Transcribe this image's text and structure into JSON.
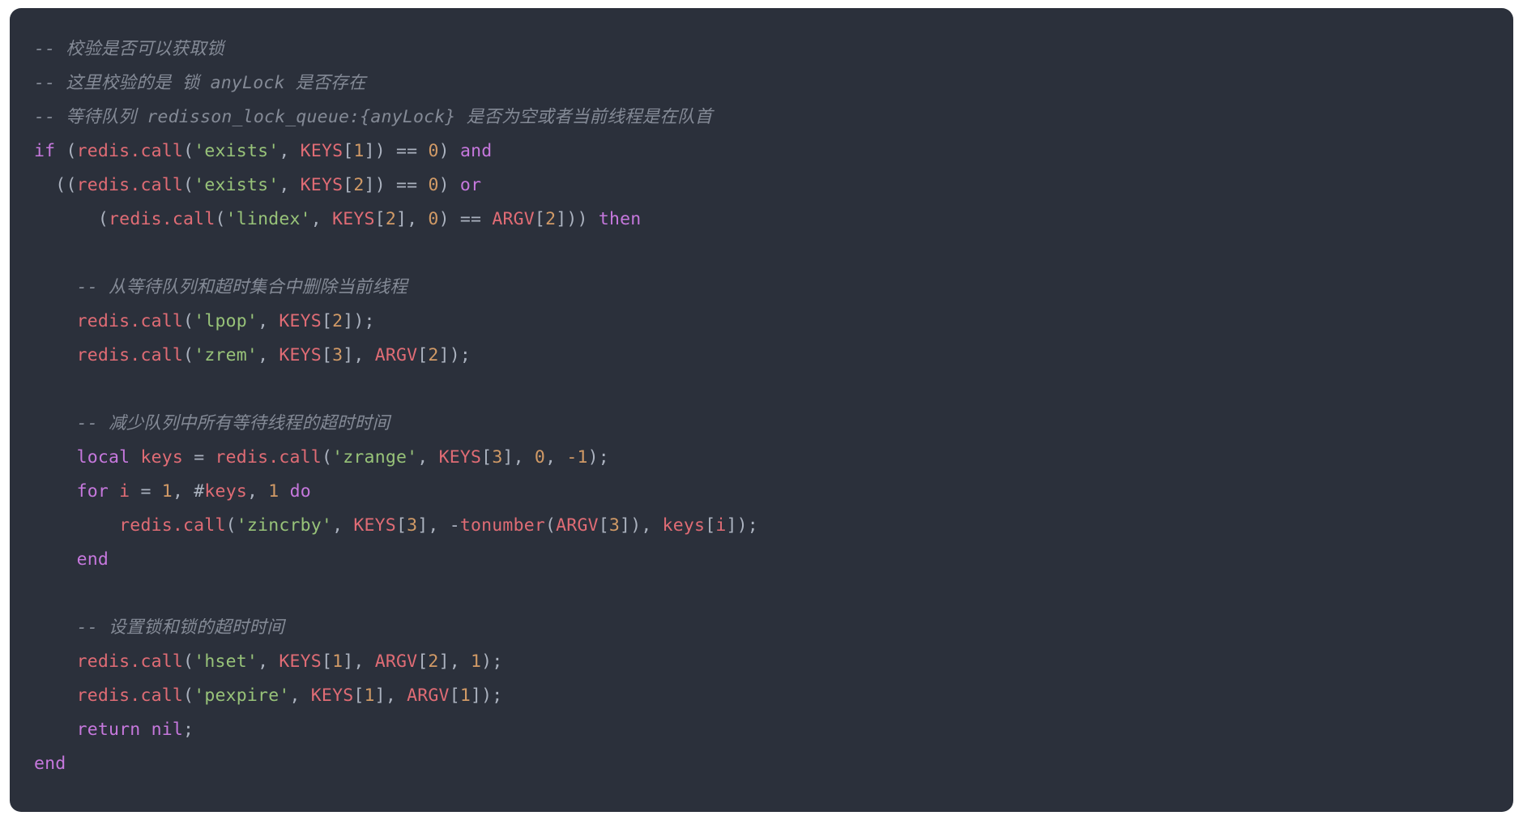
{
  "editor": {
    "language": "lua",
    "background_color": "#2b303b",
    "page_background_color": "#ffffff",
    "theme_colors": {
      "comment": "#848a96",
      "keyword": "#c678dd",
      "function": "#e06c75",
      "string": "#98c379",
      "number": "#d19a66",
      "punctuation": "#abb2bf"
    }
  },
  "code_lines": [
    {
      "id": "l01",
      "indent": 0,
      "tokens": [
        {
          "t": "comment",
          "v": "-- 校验是否可以获取锁"
        }
      ]
    },
    {
      "id": "l02",
      "indent": 0,
      "tokens": [
        {
          "t": "comment",
          "v": "-- 这里校验的是 锁 anyLock 是否存在"
        }
      ]
    },
    {
      "id": "l03",
      "indent": 0,
      "tokens": [
        {
          "t": "comment",
          "v": "-- 等待队列 redisson_lock_queue:{anyLock} 是否为空或者当前线程是在队首"
        }
      ]
    },
    {
      "id": "l04",
      "indent": 0,
      "tokens": [
        {
          "t": "keyword",
          "v": "if"
        },
        {
          "t": "plain",
          "v": " "
        },
        {
          "t": "punctuation",
          "v": "("
        },
        {
          "t": "function",
          "v": "redis.call"
        },
        {
          "t": "punctuation",
          "v": "("
        },
        {
          "t": "string",
          "v": "'exists'"
        },
        {
          "t": "punctuation",
          "v": ", "
        },
        {
          "t": "function",
          "v": "KEYS"
        },
        {
          "t": "punctuation",
          "v": "["
        },
        {
          "t": "number",
          "v": "1"
        },
        {
          "t": "punctuation",
          "v": "])"
        },
        {
          "t": "plain",
          "v": " "
        },
        {
          "t": "punctuation",
          "v": "=="
        },
        {
          "t": "plain",
          "v": " "
        },
        {
          "t": "number",
          "v": "0"
        },
        {
          "t": "punctuation",
          "v": ")"
        },
        {
          "t": "plain",
          "v": " "
        },
        {
          "t": "keyword",
          "v": "and"
        }
      ]
    },
    {
      "id": "l05",
      "indent": 0,
      "tokens": [
        {
          "t": "plain",
          "v": "  "
        },
        {
          "t": "punctuation",
          "v": "(("
        },
        {
          "t": "function",
          "v": "redis.call"
        },
        {
          "t": "punctuation",
          "v": "("
        },
        {
          "t": "string",
          "v": "'exists'"
        },
        {
          "t": "punctuation",
          "v": ", "
        },
        {
          "t": "function",
          "v": "KEYS"
        },
        {
          "t": "punctuation",
          "v": "["
        },
        {
          "t": "number",
          "v": "2"
        },
        {
          "t": "punctuation",
          "v": "])"
        },
        {
          "t": "plain",
          "v": " "
        },
        {
          "t": "punctuation",
          "v": "=="
        },
        {
          "t": "plain",
          "v": " "
        },
        {
          "t": "number",
          "v": "0"
        },
        {
          "t": "punctuation",
          "v": ")"
        },
        {
          "t": "plain",
          "v": " "
        },
        {
          "t": "keyword",
          "v": "or"
        }
      ]
    },
    {
      "id": "l06",
      "indent": 0,
      "tokens": [
        {
          "t": "plain",
          "v": "      "
        },
        {
          "t": "punctuation",
          "v": "("
        },
        {
          "t": "function",
          "v": "redis.call"
        },
        {
          "t": "punctuation",
          "v": "("
        },
        {
          "t": "string",
          "v": "'lindex'"
        },
        {
          "t": "punctuation",
          "v": ", "
        },
        {
          "t": "function",
          "v": "KEYS"
        },
        {
          "t": "punctuation",
          "v": "["
        },
        {
          "t": "number",
          "v": "2"
        },
        {
          "t": "punctuation",
          "v": "], "
        },
        {
          "t": "number",
          "v": "0"
        },
        {
          "t": "punctuation",
          "v": ")"
        },
        {
          "t": "plain",
          "v": " "
        },
        {
          "t": "punctuation",
          "v": "=="
        },
        {
          "t": "plain",
          "v": " "
        },
        {
          "t": "function",
          "v": "ARGV"
        },
        {
          "t": "punctuation",
          "v": "["
        },
        {
          "t": "number",
          "v": "2"
        },
        {
          "t": "punctuation",
          "v": "]))"
        },
        {
          "t": "plain",
          "v": " "
        },
        {
          "t": "keyword",
          "v": "then"
        }
      ]
    },
    {
      "id": "l07",
      "indent": 0,
      "tokens": []
    },
    {
      "id": "l08",
      "indent": 0,
      "tokens": [
        {
          "t": "plain",
          "v": "    "
        },
        {
          "t": "comment",
          "v": "-- 从等待队列和超时集合中删除当前线程"
        }
      ]
    },
    {
      "id": "l09",
      "indent": 0,
      "tokens": [
        {
          "t": "plain",
          "v": "    "
        },
        {
          "t": "function",
          "v": "redis.call"
        },
        {
          "t": "punctuation",
          "v": "("
        },
        {
          "t": "string",
          "v": "'lpop'"
        },
        {
          "t": "punctuation",
          "v": ", "
        },
        {
          "t": "function",
          "v": "KEYS"
        },
        {
          "t": "punctuation",
          "v": "["
        },
        {
          "t": "number",
          "v": "2"
        },
        {
          "t": "punctuation",
          "v": "]);"
        }
      ]
    },
    {
      "id": "l10",
      "indent": 0,
      "tokens": [
        {
          "t": "plain",
          "v": "    "
        },
        {
          "t": "function",
          "v": "redis.call"
        },
        {
          "t": "punctuation",
          "v": "("
        },
        {
          "t": "string",
          "v": "'zrem'"
        },
        {
          "t": "punctuation",
          "v": ", "
        },
        {
          "t": "function",
          "v": "KEYS"
        },
        {
          "t": "punctuation",
          "v": "["
        },
        {
          "t": "number",
          "v": "3"
        },
        {
          "t": "punctuation",
          "v": "], "
        },
        {
          "t": "function",
          "v": "ARGV"
        },
        {
          "t": "punctuation",
          "v": "["
        },
        {
          "t": "number",
          "v": "2"
        },
        {
          "t": "punctuation",
          "v": "]);"
        }
      ]
    },
    {
      "id": "l11",
      "indent": 0,
      "tokens": []
    },
    {
      "id": "l12",
      "indent": 0,
      "tokens": [
        {
          "t": "plain",
          "v": "    "
        },
        {
          "t": "comment",
          "v": "-- 减少队列中所有等待线程的超时时间"
        }
      ]
    },
    {
      "id": "l13",
      "indent": 0,
      "tokens": [
        {
          "t": "plain",
          "v": "    "
        },
        {
          "t": "keyword",
          "v": "local"
        },
        {
          "t": "plain",
          "v": " "
        },
        {
          "t": "function",
          "v": "keys"
        },
        {
          "t": "plain",
          "v": " "
        },
        {
          "t": "punctuation",
          "v": "="
        },
        {
          "t": "plain",
          "v": " "
        },
        {
          "t": "function",
          "v": "redis.call"
        },
        {
          "t": "punctuation",
          "v": "("
        },
        {
          "t": "string",
          "v": "'zrange'"
        },
        {
          "t": "punctuation",
          "v": ", "
        },
        {
          "t": "function",
          "v": "KEYS"
        },
        {
          "t": "punctuation",
          "v": "["
        },
        {
          "t": "number",
          "v": "3"
        },
        {
          "t": "punctuation",
          "v": "], "
        },
        {
          "t": "number",
          "v": "0"
        },
        {
          "t": "punctuation",
          "v": ", "
        },
        {
          "t": "number",
          "v": "-1"
        },
        {
          "t": "punctuation",
          "v": ");"
        }
      ]
    },
    {
      "id": "l14",
      "indent": 0,
      "tokens": [
        {
          "t": "plain",
          "v": "    "
        },
        {
          "t": "keyword",
          "v": "for"
        },
        {
          "t": "plain",
          "v": " "
        },
        {
          "t": "function",
          "v": "i"
        },
        {
          "t": "plain",
          "v": " "
        },
        {
          "t": "punctuation",
          "v": "="
        },
        {
          "t": "plain",
          "v": " "
        },
        {
          "t": "number",
          "v": "1"
        },
        {
          "t": "punctuation",
          "v": ", "
        },
        {
          "t": "punctuation",
          "v": "#"
        },
        {
          "t": "function",
          "v": "keys"
        },
        {
          "t": "punctuation",
          "v": ", "
        },
        {
          "t": "number",
          "v": "1"
        },
        {
          "t": "plain",
          "v": " "
        },
        {
          "t": "keyword",
          "v": "do"
        }
      ]
    },
    {
      "id": "l15",
      "indent": 0,
      "tokens": [
        {
          "t": "plain",
          "v": "        "
        },
        {
          "t": "function",
          "v": "redis.call"
        },
        {
          "t": "punctuation",
          "v": "("
        },
        {
          "t": "string",
          "v": "'zincrby'"
        },
        {
          "t": "punctuation",
          "v": ", "
        },
        {
          "t": "function",
          "v": "KEYS"
        },
        {
          "t": "punctuation",
          "v": "["
        },
        {
          "t": "number",
          "v": "3"
        },
        {
          "t": "punctuation",
          "v": "], "
        },
        {
          "t": "punctuation",
          "v": "-"
        },
        {
          "t": "function",
          "v": "tonumber"
        },
        {
          "t": "punctuation",
          "v": "("
        },
        {
          "t": "function",
          "v": "ARGV"
        },
        {
          "t": "punctuation",
          "v": "["
        },
        {
          "t": "number",
          "v": "3"
        },
        {
          "t": "punctuation",
          "v": "]), "
        },
        {
          "t": "function",
          "v": "keys"
        },
        {
          "t": "punctuation",
          "v": "["
        },
        {
          "t": "function",
          "v": "i"
        },
        {
          "t": "punctuation",
          "v": "]);"
        }
      ]
    },
    {
      "id": "l16",
      "indent": 0,
      "tokens": [
        {
          "t": "plain",
          "v": "    "
        },
        {
          "t": "keyword",
          "v": "end"
        }
      ]
    },
    {
      "id": "l17",
      "indent": 0,
      "tokens": []
    },
    {
      "id": "l18",
      "indent": 0,
      "tokens": [
        {
          "t": "plain",
          "v": "    "
        },
        {
          "t": "comment",
          "v": "-- 设置锁和锁的超时时间"
        }
      ]
    },
    {
      "id": "l19",
      "indent": 0,
      "tokens": [
        {
          "t": "plain",
          "v": "    "
        },
        {
          "t": "function",
          "v": "redis.call"
        },
        {
          "t": "punctuation",
          "v": "("
        },
        {
          "t": "string",
          "v": "'hset'"
        },
        {
          "t": "punctuation",
          "v": ", "
        },
        {
          "t": "function",
          "v": "KEYS"
        },
        {
          "t": "punctuation",
          "v": "["
        },
        {
          "t": "number",
          "v": "1"
        },
        {
          "t": "punctuation",
          "v": "], "
        },
        {
          "t": "function",
          "v": "ARGV"
        },
        {
          "t": "punctuation",
          "v": "["
        },
        {
          "t": "number",
          "v": "2"
        },
        {
          "t": "punctuation",
          "v": "], "
        },
        {
          "t": "number",
          "v": "1"
        },
        {
          "t": "punctuation",
          "v": ");"
        }
      ]
    },
    {
      "id": "l20",
      "indent": 0,
      "tokens": [
        {
          "t": "plain",
          "v": "    "
        },
        {
          "t": "function",
          "v": "redis.call"
        },
        {
          "t": "punctuation",
          "v": "("
        },
        {
          "t": "string",
          "v": "'pexpire'"
        },
        {
          "t": "punctuation",
          "v": ", "
        },
        {
          "t": "function",
          "v": "KEYS"
        },
        {
          "t": "punctuation",
          "v": "["
        },
        {
          "t": "number",
          "v": "1"
        },
        {
          "t": "punctuation",
          "v": "], "
        },
        {
          "t": "function",
          "v": "ARGV"
        },
        {
          "t": "punctuation",
          "v": "["
        },
        {
          "t": "number",
          "v": "1"
        },
        {
          "t": "punctuation",
          "v": "]);"
        }
      ]
    },
    {
      "id": "l21",
      "indent": 0,
      "tokens": [
        {
          "t": "plain",
          "v": "    "
        },
        {
          "t": "keyword",
          "v": "return"
        },
        {
          "t": "plain",
          "v": " "
        },
        {
          "t": "keyword",
          "v": "nil"
        },
        {
          "t": "punctuation",
          "v": ";"
        }
      ]
    },
    {
      "id": "l22",
      "indent": 0,
      "tokens": [
        {
          "t": "keyword",
          "v": "end"
        }
      ]
    }
  ]
}
